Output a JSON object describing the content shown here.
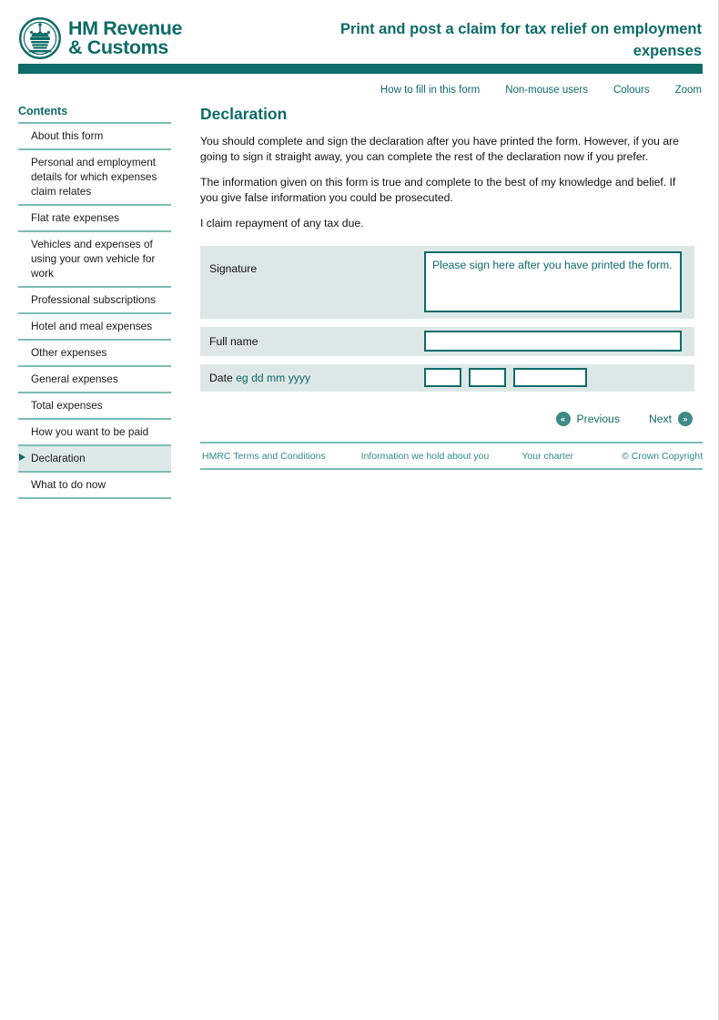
{
  "header": {
    "logo_text": "HM Revenue\n& Customs",
    "logo_icon": "royal-crest-icon",
    "title": "Print and post a claim for tax relief on employment expenses",
    "accent_color": "#0d6b68"
  },
  "utility_nav": {
    "items": [
      {
        "label": "How to fill in this form"
      },
      {
        "label": "Non-mouse users"
      },
      {
        "label": "Colours"
      },
      {
        "label": "Zoom"
      }
    ]
  },
  "sidebar": {
    "title": "Contents",
    "items": [
      {
        "label": "About this form",
        "active": false
      },
      {
        "label": "Personal and employment details for which expenses claim relates",
        "active": false
      },
      {
        "label": "Flat rate expenses",
        "active": false
      },
      {
        "label": "Vehicles and expenses of using your own vehicle for work",
        "active": false
      },
      {
        "label": "Professional subscriptions",
        "active": false
      },
      {
        "label": "Hotel and meal expenses",
        "active": false
      },
      {
        "label": "Other expenses",
        "active": false
      },
      {
        "label": "General expenses",
        "active": false
      },
      {
        "label": "Total expenses",
        "active": false
      },
      {
        "label": "How you want to be paid",
        "active": false
      },
      {
        "label": "Declaration",
        "active": true
      },
      {
        "label": "What to do now",
        "active": false
      }
    ]
  },
  "main": {
    "section_title": "Declaration",
    "paragraphs": [
      "You should complete and sign the declaration after you have printed the form. However, if you are going to sign it straight away, you can complete the rest of the declaration now if you prefer.",
      "The information given on this form is true and complete to the best of my knowledge and belief. If you give false information you could be prosecuted.",
      "I claim repayment of any tax due."
    ],
    "signature": {
      "label": "Signature",
      "value": "Please sign here after you have printed the form.",
      "placeholder": "Please sign here after you have printed the form."
    },
    "full_name": {
      "label": "Full name",
      "value": "",
      "placeholder": ""
    },
    "date": {
      "label": "Date",
      "hint": "eg dd mm yyyy",
      "day": {
        "value": "",
        "placeholder": ""
      },
      "month": {
        "value": "",
        "placeholder": ""
      },
      "year": {
        "value": "",
        "placeholder": ""
      }
    }
  },
  "pager": {
    "previous_label": "Previous",
    "previous_icon": "double-chevron-left-icon",
    "previous_glyph": "«",
    "next_label": "Next",
    "next_icon": "double-chevron-right-icon",
    "next_glyph": "»"
  },
  "footer": {
    "links": [
      {
        "label": "HMRC Terms and Conditions"
      },
      {
        "label": "Information we hold about you"
      },
      {
        "label": "Your charter"
      },
      {
        "label": "© Crown Copyright"
      }
    ]
  }
}
